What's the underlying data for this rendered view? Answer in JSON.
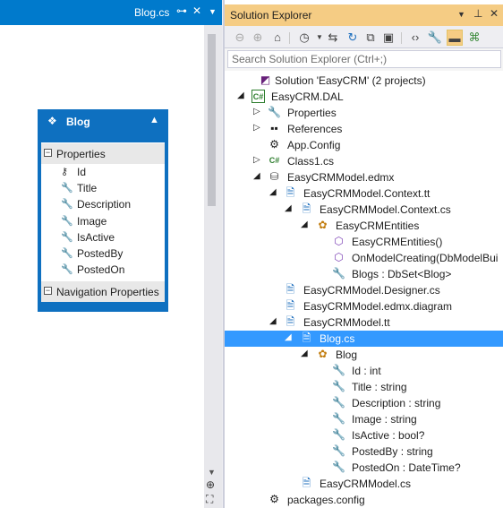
{
  "designer": {
    "tab_title": "Blog.cs",
    "entity": {
      "title": "Blog",
      "properties_label": "Properties",
      "navigation_label": "Navigation Properties",
      "properties": [
        "Id",
        "Title",
        "Description",
        "Image",
        "IsActive",
        "PostedBy",
        "PostedOn"
      ]
    }
  },
  "solution_explorer": {
    "title": "Solution Explorer",
    "search_placeholder": "Search Solution Explorer (Ctrl+;)",
    "accent_color": "#f5cc84",
    "selection_color": "#3399ff",
    "tree": [
      {
        "text": "Solution 'EasyCRM' (2 projects)",
        "icon": "solution-icon"
      },
      {
        "text": "EasyCRM.DAL",
        "icon": "csharp-project-icon"
      },
      {
        "text": "Properties",
        "icon": "wrench-icon"
      },
      {
        "text": "References",
        "icon": "references-icon"
      },
      {
        "text": "App.Config",
        "icon": "config-file-icon"
      },
      {
        "text": "Class1.cs",
        "icon": "csharp-file-icon"
      },
      {
        "text": "EasyCRMModel.edmx",
        "icon": "edmx-icon"
      },
      {
        "text": "EasyCRMModel.Context.tt",
        "icon": "tt-file-icon"
      },
      {
        "text": "EasyCRMModel.Context.cs",
        "icon": "cs-file-icon"
      },
      {
        "text": "EasyCRMEntities",
        "icon": "class-icon"
      },
      {
        "text": "EasyCRMEntities()",
        "icon": "method-icon"
      },
      {
        "text": "OnModelCreating(DbModelBui",
        "icon": "method-protected-icon"
      },
      {
        "text": "Blogs : DbSet<Blog>",
        "icon": "property-icon"
      },
      {
        "text": "EasyCRMModel.Designer.cs",
        "icon": "cs-file-icon"
      },
      {
        "text": "EasyCRMModel.edmx.diagram",
        "icon": "cs-file-icon"
      },
      {
        "text": "EasyCRMModel.tt",
        "icon": "tt-file-icon"
      },
      {
        "text": "Blog.cs",
        "icon": "cs-file-icon"
      },
      {
        "text": "Blog",
        "icon": "class-icon"
      },
      {
        "text": "Id : int",
        "icon": "property-icon"
      },
      {
        "text": "Title : string",
        "icon": "property-icon"
      },
      {
        "text": "Description : string",
        "icon": "property-icon"
      },
      {
        "text": "Image : string",
        "icon": "property-icon"
      },
      {
        "text": "IsActive : bool?",
        "icon": "property-icon"
      },
      {
        "text": "PostedBy : string",
        "icon": "property-icon"
      },
      {
        "text": "PostedOn : DateTime?",
        "icon": "property-icon"
      },
      {
        "text": "EasyCRMModel.cs",
        "icon": "cs-file-icon"
      },
      {
        "text": "packages.config",
        "icon": "config-file-icon"
      }
    ]
  }
}
